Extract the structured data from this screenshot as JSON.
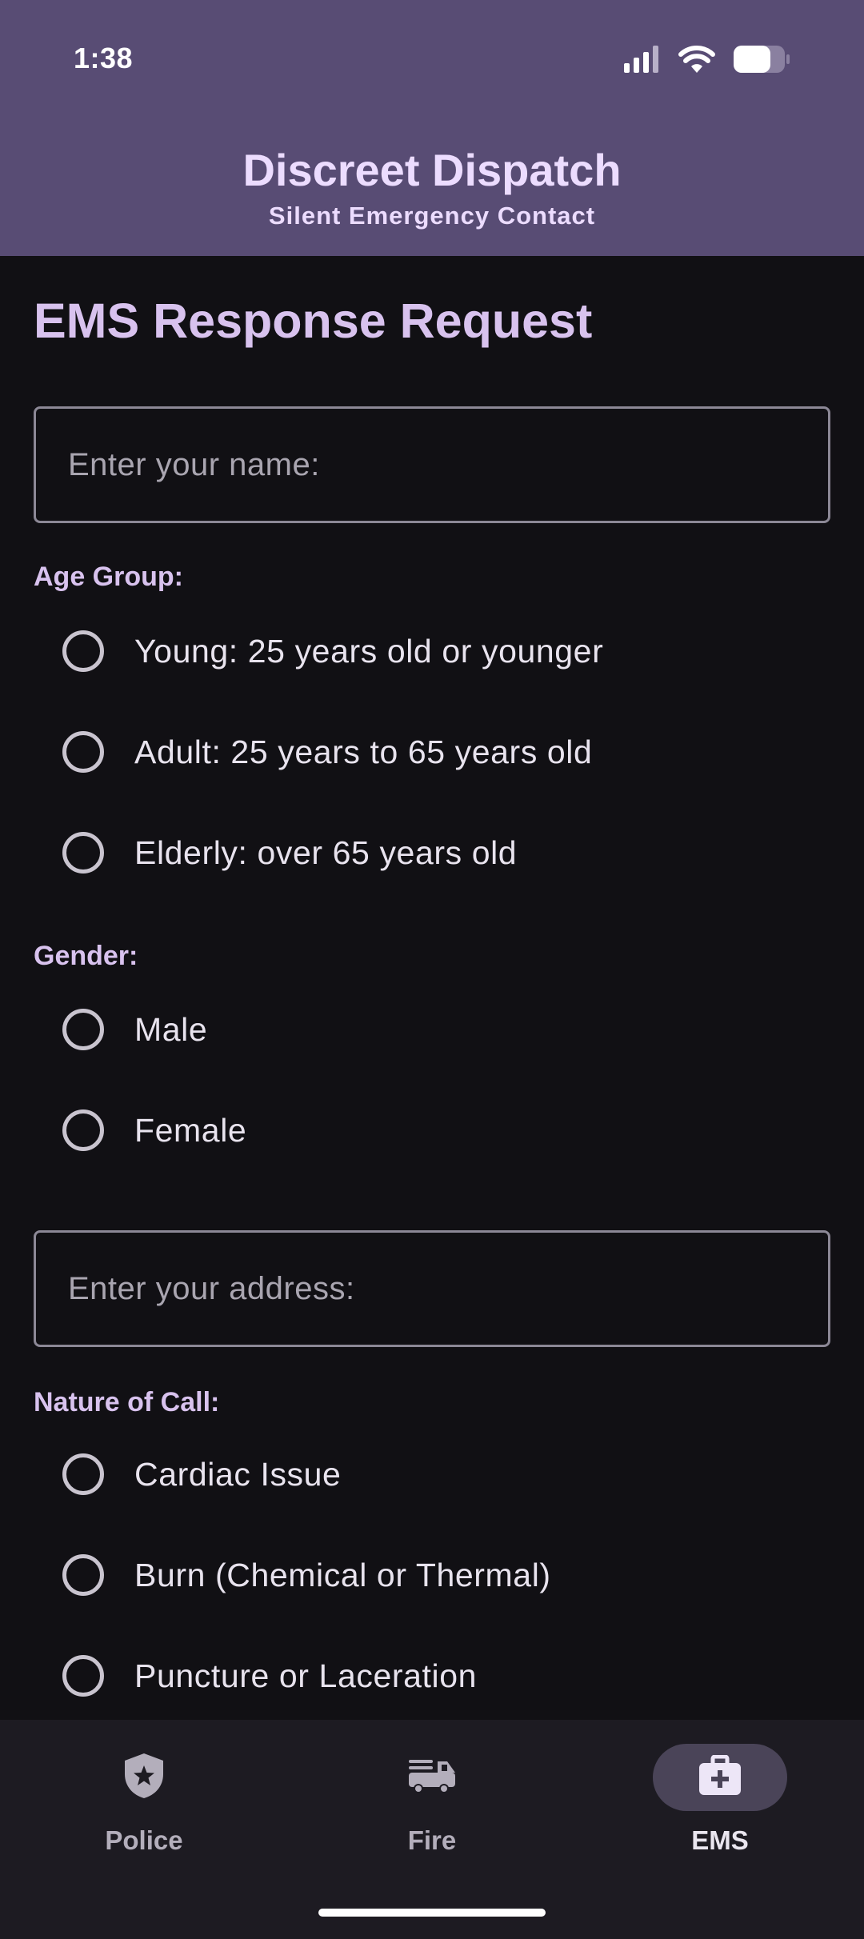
{
  "status_bar": {
    "time": "1:38"
  },
  "app_bar": {
    "title": "Discreet Dispatch",
    "subtitle": "Silent Emergency Contact"
  },
  "form": {
    "heading": "EMS Response Request",
    "name_field": {
      "placeholder": "Enter your name:",
      "value": ""
    },
    "age_group": {
      "label": "Age Group:",
      "options": [
        {
          "label": "Young: 25 years old or younger",
          "selected": false
        },
        {
          "label": "Adult: 25 years to 65 years old",
          "selected": false
        },
        {
          "label": "Elderly: over 65 years old",
          "selected": false
        }
      ]
    },
    "gender": {
      "label": "Gender:",
      "options": [
        {
          "label": "Male",
          "selected": false
        },
        {
          "label": "Female",
          "selected": false
        }
      ]
    },
    "address_field": {
      "placeholder": "Enter your address:",
      "value": ""
    },
    "nature_of_call": {
      "label": "Nature of Call:",
      "options": [
        {
          "label": "Cardiac Issue",
          "selected": false
        },
        {
          "label": "Burn (Chemical or Thermal)",
          "selected": false
        },
        {
          "label": "Puncture or Laceration",
          "selected": false
        }
      ]
    }
  },
  "bottom_nav": {
    "items": [
      {
        "label": "Police",
        "icon": "shield-star-icon",
        "active": false
      },
      {
        "label": "Fire",
        "icon": "fire-truck-icon",
        "active": false
      },
      {
        "label": "EMS",
        "icon": "medical-bag-icon",
        "active": true
      }
    ]
  },
  "colors": {
    "app_bar": "#584c74",
    "background": "#111014",
    "accent_text": "#d8c2ee",
    "nav_background": "#1d1b22",
    "nav_active_pill": "#4a4458"
  }
}
